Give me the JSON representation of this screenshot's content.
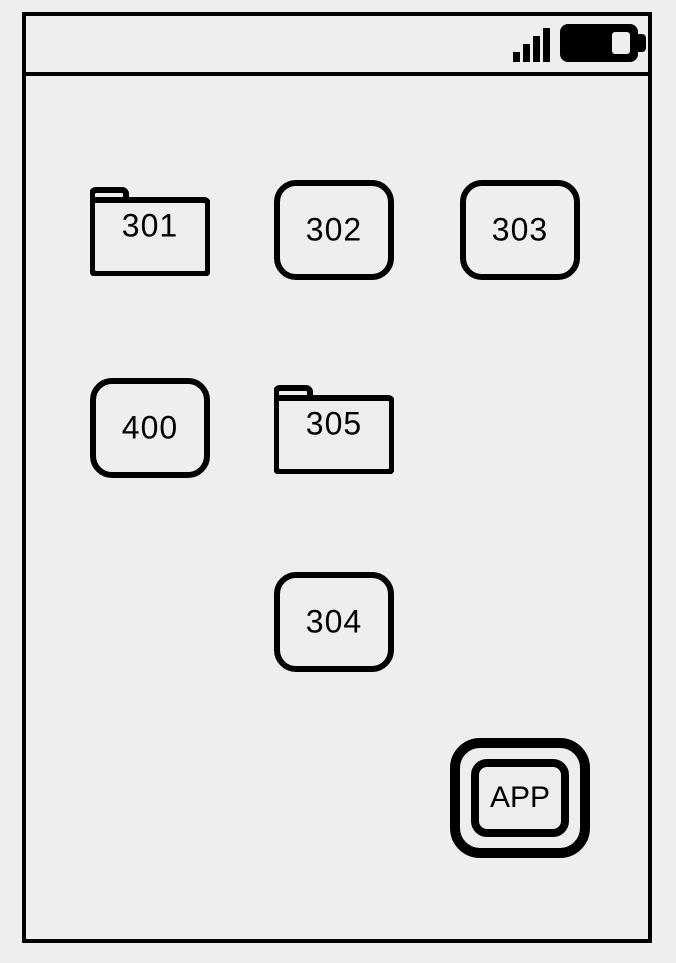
{
  "grid": {
    "r1c1": {
      "label": "301",
      "type": "folder"
    },
    "r1c2": {
      "label": "302",
      "type": "app"
    },
    "r1c3": {
      "label": "303",
      "type": "app"
    },
    "r2c1": {
      "label": "400",
      "type": "app"
    },
    "r2c2": {
      "label": "305",
      "type": "folder"
    },
    "r3c2": {
      "label": "304",
      "type": "app"
    }
  },
  "floating": {
    "label": "APP"
  }
}
